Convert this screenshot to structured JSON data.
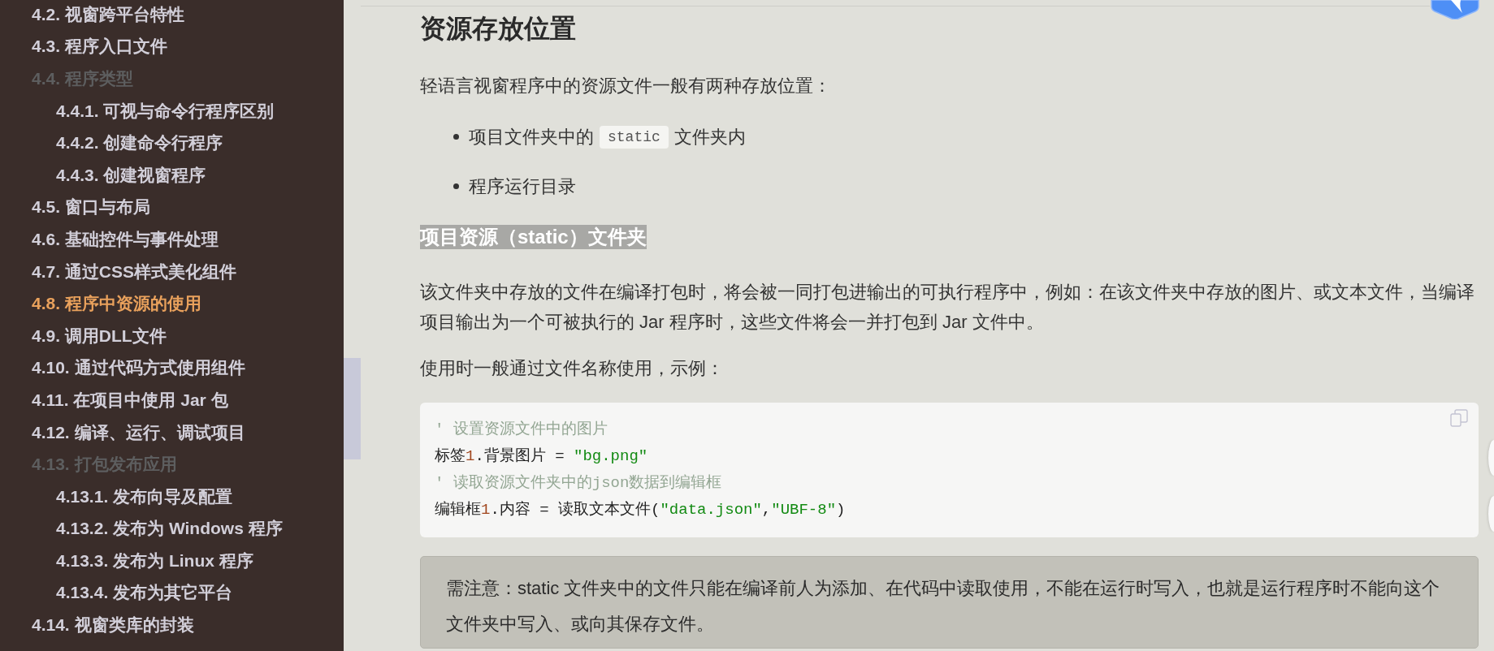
{
  "sidebar": {
    "items": [
      {
        "label": "4.2. 视窗跨平台特性",
        "selected": false,
        "disabled": false
      },
      {
        "label": "4.3. 程序入口文件",
        "selected": false,
        "disabled": false
      },
      {
        "label": "4.4. 程序类型",
        "selected": false,
        "disabled": true,
        "children": [
          {
            "label": "4.4.1. 可视与命令行程序区别",
            "selected": false,
            "disabled": false
          },
          {
            "label": "4.4.2. 创建命令行程序",
            "selected": false,
            "disabled": false
          },
          {
            "label": "4.4.3. 创建视窗程序",
            "selected": false,
            "disabled": false
          }
        ]
      },
      {
        "label": "4.5. 窗口与布局",
        "selected": false,
        "disabled": false
      },
      {
        "label": "4.6. 基础控件与事件处理",
        "selected": false,
        "disabled": false
      },
      {
        "label": "4.7. 通过CSS样式美化组件",
        "selected": false,
        "disabled": false
      },
      {
        "label": "4.8. 程序中资源的使用",
        "selected": true,
        "disabled": false
      },
      {
        "label": "4.9. 调用DLL文件",
        "selected": false,
        "disabled": false
      },
      {
        "label": "4.10. 通过代码方式使用组件",
        "selected": false,
        "disabled": false
      },
      {
        "label": "4.11. 在项目中使用 Jar 包",
        "selected": false,
        "disabled": false
      },
      {
        "label": "4.12. 编译、运行、调试项目",
        "selected": false,
        "disabled": false
      },
      {
        "label": "4.13. 打包发布应用",
        "selected": false,
        "disabled": true,
        "children": [
          {
            "label": "4.13.1. 发布向导及配置",
            "selected": false,
            "disabled": false
          },
          {
            "label": "4.13.2. 发布为 Windows 程序",
            "selected": false,
            "disabled": false
          },
          {
            "label": "4.13.3. 发布为 Linux 程序",
            "selected": false,
            "disabled": false
          },
          {
            "label": "4.13.4. 发布为其它平台",
            "selected": false,
            "disabled": false
          }
        ]
      },
      {
        "label": "4.14. 视窗类库的封装",
        "selected": false,
        "disabled": false
      }
    ]
  },
  "article": {
    "heading": "资源存放位置",
    "blocks": [
      {
        "kind": "paragraph",
        "text": "轻语言视窗程序中的资源文件一般有两种存放位置："
      },
      {
        "kind": "list",
        "items": [
          {
            "parts": [
              {
                "kind": "text",
                "text": "项目文件夹中的"
              },
              {
                "kind": "code",
                "text": "static"
              },
              {
                "kind": "text",
                "text": "文件夹内"
              }
            ]
          },
          {
            "parts": [
              {
                "kind": "text",
                "text": "程序运行目录"
              }
            ]
          }
        ]
      },
      {
        "kind": "subheading",
        "text": "项目资源（static）文件夹",
        "highlighted": true
      },
      {
        "kind": "paragraph",
        "text": "该文件夹中存放的文件在编译打包时，将会被一同打包进输出的可执行程序中，例如：在该文件夹中存放的图片、或文本文件，当编译项目输出为一个可被执行的 Jar 程序时，这些文件将会一并打包到 Jar 文件中。"
      },
      {
        "kind": "paragraph",
        "text": "使用时一般通过文件名称使用，示例："
      },
      {
        "kind": "code",
        "lines": [
          [
            {
              "kind": "comment",
              "text": "' 设置资源文件中的图片"
            }
          ],
          [
            {
              "kind": "plain",
              "text": "标签"
            },
            {
              "kind": "number",
              "text": "1"
            },
            {
              "kind": "plain",
              "text": ".背景图片 = "
            },
            {
              "kind": "string",
              "text": "\"bg.png\""
            }
          ],
          [
            {
              "kind": "comment",
              "text": "' 读取资源文件夹中的json数据到编辑框"
            }
          ],
          [
            {
              "kind": "plain",
              "text": "编辑框"
            },
            {
              "kind": "number",
              "text": "1"
            },
            {
              "kind": "plain",
              "text": ".内容 = 读取文本文件("
            },
            {
              "kind": "string",
              "text": "\"data.json\""
            },
            {
              "kind": "plain",
              "text": ","
            },
            {
              "kind": "string",
              "text": "\"UBF-8\""
            },
            {
              "kind": "plain",
              "text": ")"
            }
          ]
        ]
      },
      {
        "kind": "note",
        "text": "需注意：static 文件夹中的文件只能在编译前人为添加、在代码中读取使用，不能在运行时写入，也就是运行程序时不能向这个文件夹中写入、或向其保存文件。"
      }
    ]
  }
}
